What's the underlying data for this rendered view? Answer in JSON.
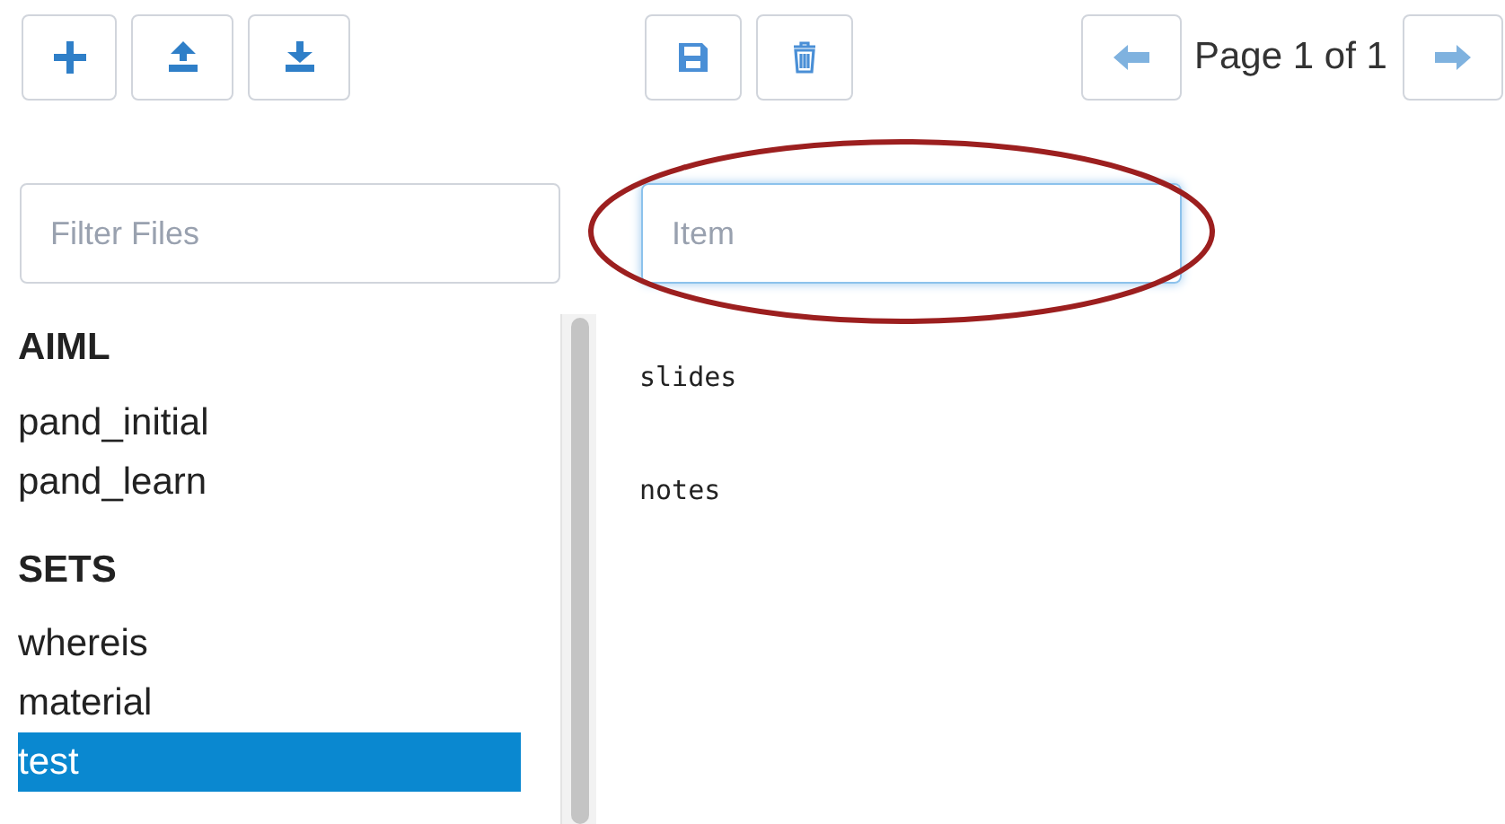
{
  "file_tools": [
    {
      "kind": "add"
    },
    {
      "kind": "upload"
    },
    {
      "kind": "download"
    }
  ],
  "item_tools": [
    {
      "kind": "save"
    },
    {
      "kind": "delete"
    }
  ],
  "pager": {
    "text": "Page 1 of 1"
  },
  "filter": {
    "placeholder": "Filter Files"
  },
  "item_field": {
    "placeholder": "Item",
    "circled": true
  },
  "sections": [
    {
      "title": "AIML",
      "items": [
        {
          "label": "pand_initial",
          "selected": false
        },
        {
          "label": "pand_learn",
          "selected": false
        }
      ]
    },
    {
      "title": "SETS",
      "items": [
        {
          "label": "whereis",
          "selected": false
        },
        {
          "label": "material",
          "selected": false
        },
        {
          "label": "test",
          "selected": true
        }
      ]
    }
  ],
  "entries": [
    "slides",
    "notes"
  ]
}
